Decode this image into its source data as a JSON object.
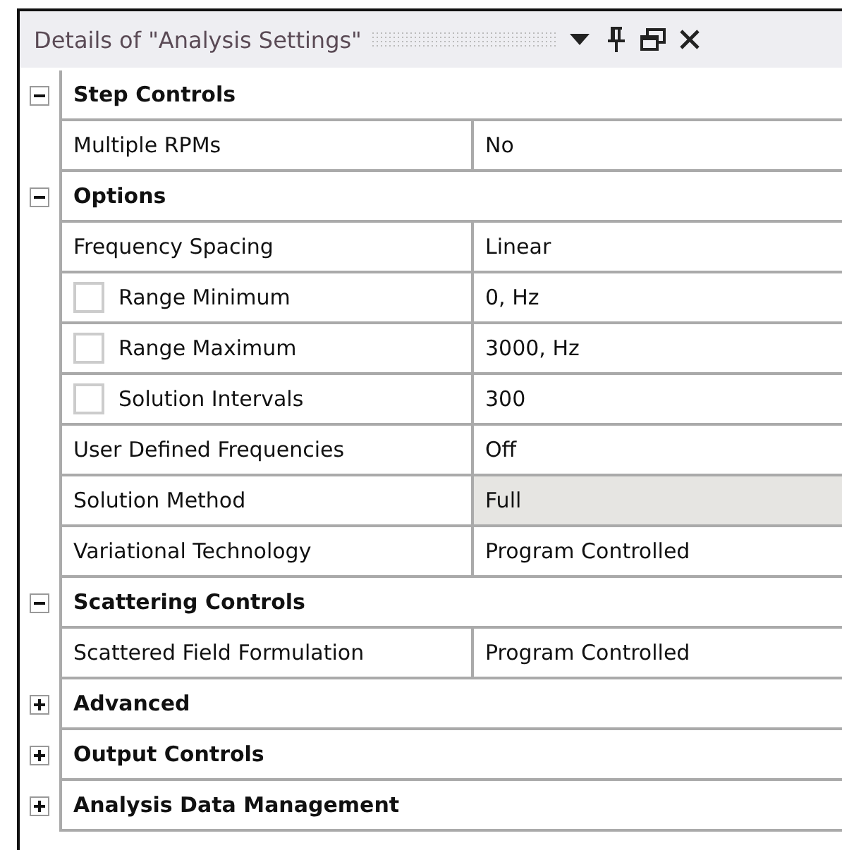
{
  "panel": {
    "title": "Details of \"Analysis Settings\""
  },
  "sections": [
    {
      "title": "Step Controls",
      "expanded": true,
      "rows": [
        {
          "kind": "plain",
          "name": "Multiple RPMs",
          "value": "No",
          "highlighted": false
        }
      ]
    },
    {
      "title": "Options",
      "expanded": true,
      "rows": [
        {
          "kind": "plain",
          "name": "Frequency Spacing",
          "value": "Linear",
          "highlighted": false
        },
        {
          "kind": "checkbox",
          "checked": false,
          "name": "Range Minimum",
          "value": "0, Hz",
          "highlighted": false
        },
        {
          "kind": "checkbox",
          "checked": false,
          "name": "Range Maximum",
          "value": "3000, Hz",
          "highlighted": false
        },
        {
          "kind": "checkbox",
          "checked": false,
          "name": "Solution Intervals",
          "value": "300",
          "highlighted": false
        },
        {
          "kind": "plain",
          "name": "User Defined Frequencies",
          "value": "Off",
          "highlighted": false
        },
        {
          "kind": "plain",
          "name": "Solution Method",
          "value": "Full",
          "highlighted": true
        },
        {
          "kind": "plain",
          "name": "Variational Technology",
          "value": "Program Controlled",
          "highlighted": false
        }
      ]
    },
    {
      "title": "Scattering Controls",
      "expanded": true,
      "rows": [
        {
          "kind": "plain",
          "name": "Scattered Field Formulation",
          "value": "Program Controlled",
          "highlighted": false
        }
      ]
    },
    {
      "title": "Advanced",
      "expanded": false
    },
    {
      "title": "Output Controls",
      "expanded": false
    },
    {
      "title": "Analysis Data Management",
      "expanded": false
    }
  ]
}
